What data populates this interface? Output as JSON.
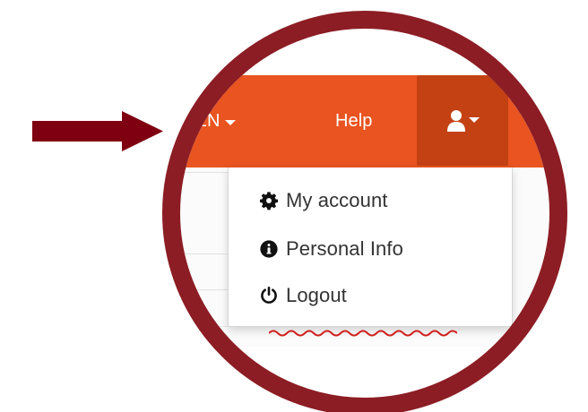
{
  "navbar": {
    "language_label": "e: EN",
    "help_label": "Help"
  },
  "dropdown": {
    "items": [
      {
        "label": "My account",
        "icon": "gear-icon"
      },
      {
        "label": "Personal Info",
        "icon": "info-icon"
      },
      {
        "label": "Logout",
        "icon": "power-icon"
      }
    ]
  },
  "colors": {
    "navbar": "#e95420",
    "user_toggle": "#c34113",
    "highlight_ring": "#8c1d24",
    "arrow": "#7f0010"
  }
}
